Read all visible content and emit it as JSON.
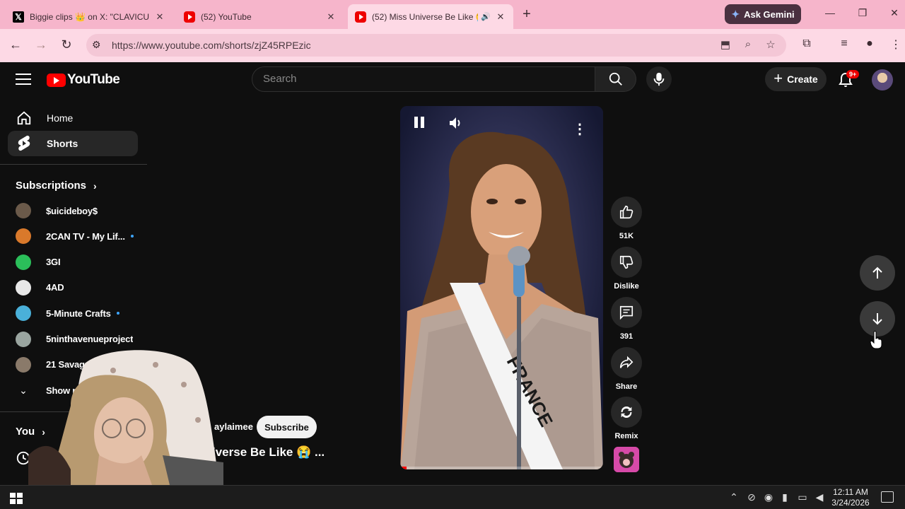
{
  "browser": {
    "tabs": [
      {
        "title": "Biggie clips 👑 on X: \"CLAVICU",
        "favicon": "x-icon"
      },
      {
        "title": "(52) YouTube",
        "favicon": "youtube-icon"
      },
      {
        "title": "(52) Miss Universe Be Like 😭",
        "favicon": "youtube-icon",
        "active": true
      }
    ],
    "new_tab": "+",
    "gemini_label": "Ask Gemini",
    "url": "https://www.youtube.com/shorts/zjZ45RPEzic"
  },
  "youtube": {
    "logo_text": "YouTube",
    "search_placeholder": "Search",
    "create_label": "Create",
    "notifications_badge": "9+"
  },
  "sidebar": {
    "main": [
      {
        "label": "Home",
        "icon": "home-icon"
      },
      {
        "label": "Shorts",
        "icon": "shorts-icon",
        "active": true
      }
    ],
    "subscriptions_title": "Subscriptions",
    "subscriptions": [
      {
        "name": "$uicideboy$",
        "color": "#6b5a4a",
        "new": false
      },
      {
        "name": "2CAN TV - My Lif...",
        "color": "#d9792b",
        "new": true
      },
      {
        "name": "3GI",
        "color": "#2bbf5a",
        "new": false
      },
      {
        "name": "4AD",
        "color": "#e8e8e8",
        "new": false
      },
      {
        "name": "5-Minute Crafts",
        "color": "#4ab0d9",
        "new": true
      },
      {
        "name": "5ninthavenueproject",
        "color": "#9aa5a0",
        "new": false
      },
      {
        "name": "21 Savage",
        "color": "#8a7a6a",
        "new": false
      }
    ],
    "show_more": "Show more",
    "you_title": "You"
  },
  "short": {
    "actions": [
      {
        "label": "51K",
        "icon": "like-icon"
      },
      {
        "label": "Dislike",
        "icon": "dislike-icon"
      },
      {
        "label": "391",
        "icon": "comment-icon"
      },
      {
        "label": "Share",
        "icon": "share-icon"
      },
      {
        "label": "Remix",
        "icon": "remix-icon"
      }
    ],
    "sash_text": "FRANCE",
    "channel_name": "aylaimee",
    "subscribe_label": "Subscribe",
    "title": "iverse Be Like 😭 ...",
    "progress": 0.03
  },
  "taskbar": {
    "time": "12:11 AM",
    "date": "3/24/2026"
  },
  "colors": {
    "yt_red": "#ff0000",
    "chrome_pink": "#f6b5cb",
    "bg": "#0f0f0f"
  }
}
